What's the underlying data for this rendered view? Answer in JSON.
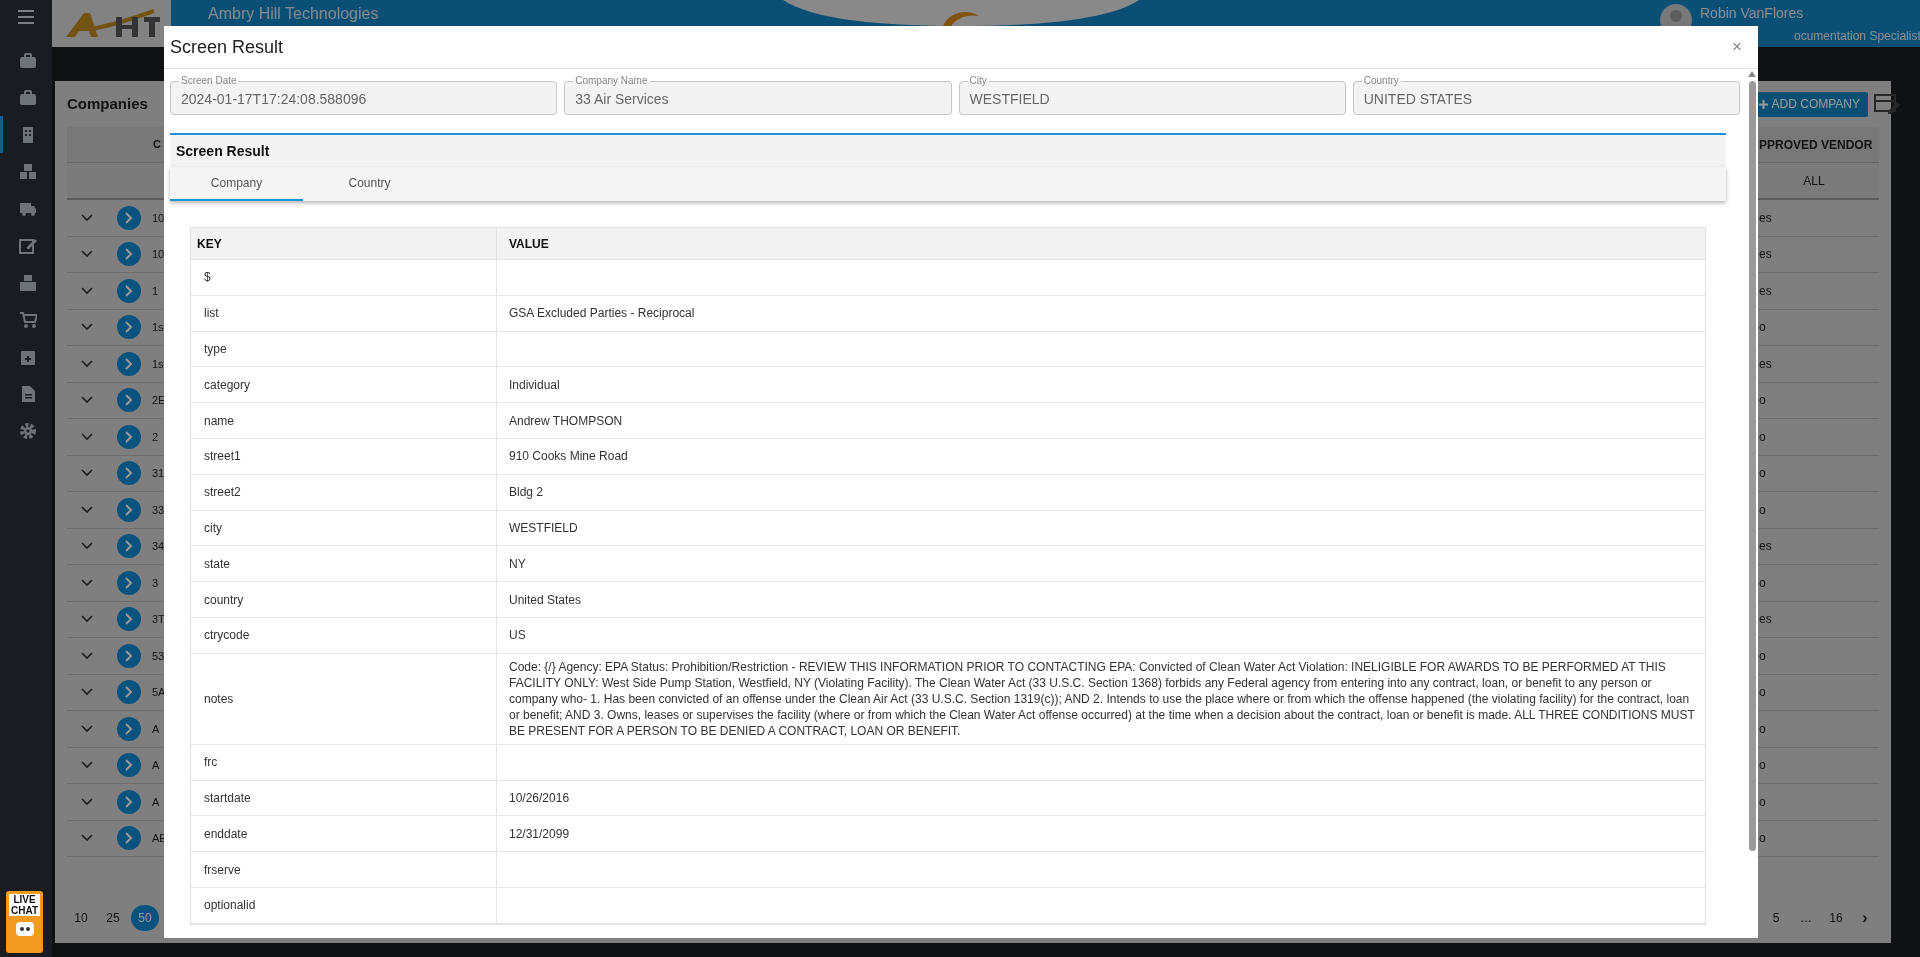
{
  "header": {
    "company": "Ambry Hill Technologies",
    "user_name": "Robin VanFlores",
    "user_role": "ocumentation Specialist"
  },
  "sidebar": {
    "items": [
      {
        "selected": false
      },
      {
        "selected": false
      },
      {
        "selected": true
      },
      {
        "selected": false
      },
      {
        "selected": false
      },
      {
        "selected": false
      },
      {
        "selected": false
      },
      {
        "selected": false
      },
      {
        "selected": false
      },
      {
        "selected": false
      },
      {
        "selected": false
      }
    ]
  },
  "companies": {
    "title": "Companies",
    "add_button": "ADD COMPANY",
    "columns": [
      "C",
      "PPROVED VENDOR"
    ],
    "vendor_filter": "ALL",
    "rows": [
      {
        "company": "10",
        "vendor": "es"
      },
      {
        "company": "10",
        "vendor": "es"
      },
      {
        "company": "1",
        "vendor": "es"
      },
      {
        "company": "1s",
        "vendor": "o"
      },
      {
        "company": "1s",
        "vendor": "es"
      },
      {
        "company": "2E",
        "vendor": "o"
      },
      {
        "company": "2",
        "vendor": "o"
      },
      {
        "company": "31",
        "vendor": "o"
      },
      {
        "company": "33",
        "vendor": "o"
      },
      {
        "company": "34",
        "vendor": "es"
      },
      {
        "company": "3",
        "vendor": "o"
      },
      {
        "company": "3T",
        "vendor": "es"
      },
      {
        "company": "53",
        "vendor": "o"
      },
      {
        "company": "5A",
        "vendor": "o"
      },
      {
        "company": "A",
        "vendor": "o"
      },
      {
        "company": "A",
        "vendor": "o"
      },
      {
        "company": "A",
        "vendor": "o"
      },
      {
        "company": "AE",
        "vendor": "o"
      }
    ],
    "page_sizes": [
      {
        "label": "10",
        "selected": false
      },
      {
        "label": "25",
        "selected": false
      },
      {
        "label": "50",
        "selected": true
      }
    ],
    "pages": [
      "5",
      "…",
      "16"
    ],
    "next": "›"
  },
  "live_chat": "LIVE CHAT",
  "modal": {
    "title": "Screen Result",
    "close": "×",
    "fields": [
      {
        "label": "Screen Date",
        "value": "2024-01-17T17:24:08.588096"
      },
      {
        "label": "Company Name",
        "value": "33 Air Services"
      },
      {
        "label": "City",
        "value": "WESTFIELD"
      },
      {
        "label": "Country",
        "value": "UNITED STATES"
      }
    ],
    "section_title": "Screen Result",
    "tabs": [
      {
        "label": "Company",
        "selected": true
      },
      {
        "label": "Country",
        "selected": false
      }
    ],
    "columns": [
      "KEY",
      "VALUE"
    ],
    "rows": [
      {
        "key": "$"
      },
      {
        "key": "list",
        "value": "GSA Excluded Parties - Reciprocal"
      },
      {
        "key": "type"
      },
      {
        "key": "category",
        "value": "Individual"
      },
      {
        "key": "name",
        "value": "Andrew THOMPSON"
      },
      {
        "key": "street1",
        "value": "910 Cooks Mine Road"
      },
      {
        "key": "street2",
        "value": "Bldg 2"
      },
      {
        "key": "city",
        "value": "WESTFIELD"
      },
      {
        "key": "state",
        "value": "NY"
      },
      {
        "key": "country",
        "value": "United States"
      },
      {
        "key": "ctrycode",
        "value": "US"
      },
      {
        "key": "notes",
        "value": "Code: {/} Agency: EPA Status: Prohibition/Restriction - REVIEW THIS INFORMATION PRIOR TO CONTACTING EPA: Convicted of Clean Water Act Violation: INELIGIBLE FOR AWARDS TO BE PERFORMED AT THIS FACILITY ONLY: West Side Pump Station, Westfield, NY (Violating Facility). The Clean Water Act (33 U.S.C. Section 1368) forbids any Federal agency from entering into any contract, loan, or benefit to any person or company who- 1. Has been convicted of an offense under the Clean Air Act (33 U.S.C. Section 1319(c)); AND 2. Intends to use the place where or from which the offense happened (the violating facility) for the contract, loan or benefit; AND 3. Owns, leases or supervises the facility (where or from which the Clean Water Act offense occurred) at the time when a decision about the contract, loan or benefit is made. ALL THREE CONDITIONS MUST BE PRESENT FOR A PERSON TO BE DENIED A CONTRACT, LOAN OR BENEFIT."
      },
      {
        "key": "frc"
      },
      {
        "key": "startdate",
        "value": "10/26/2016"
      },
      {
        "key": "enddate",
        "value": "12/31/2099"
      },
      {
        "key": "frserve"
      },
      {
        "key": "optionalid"
      }
    ]
  }
}
